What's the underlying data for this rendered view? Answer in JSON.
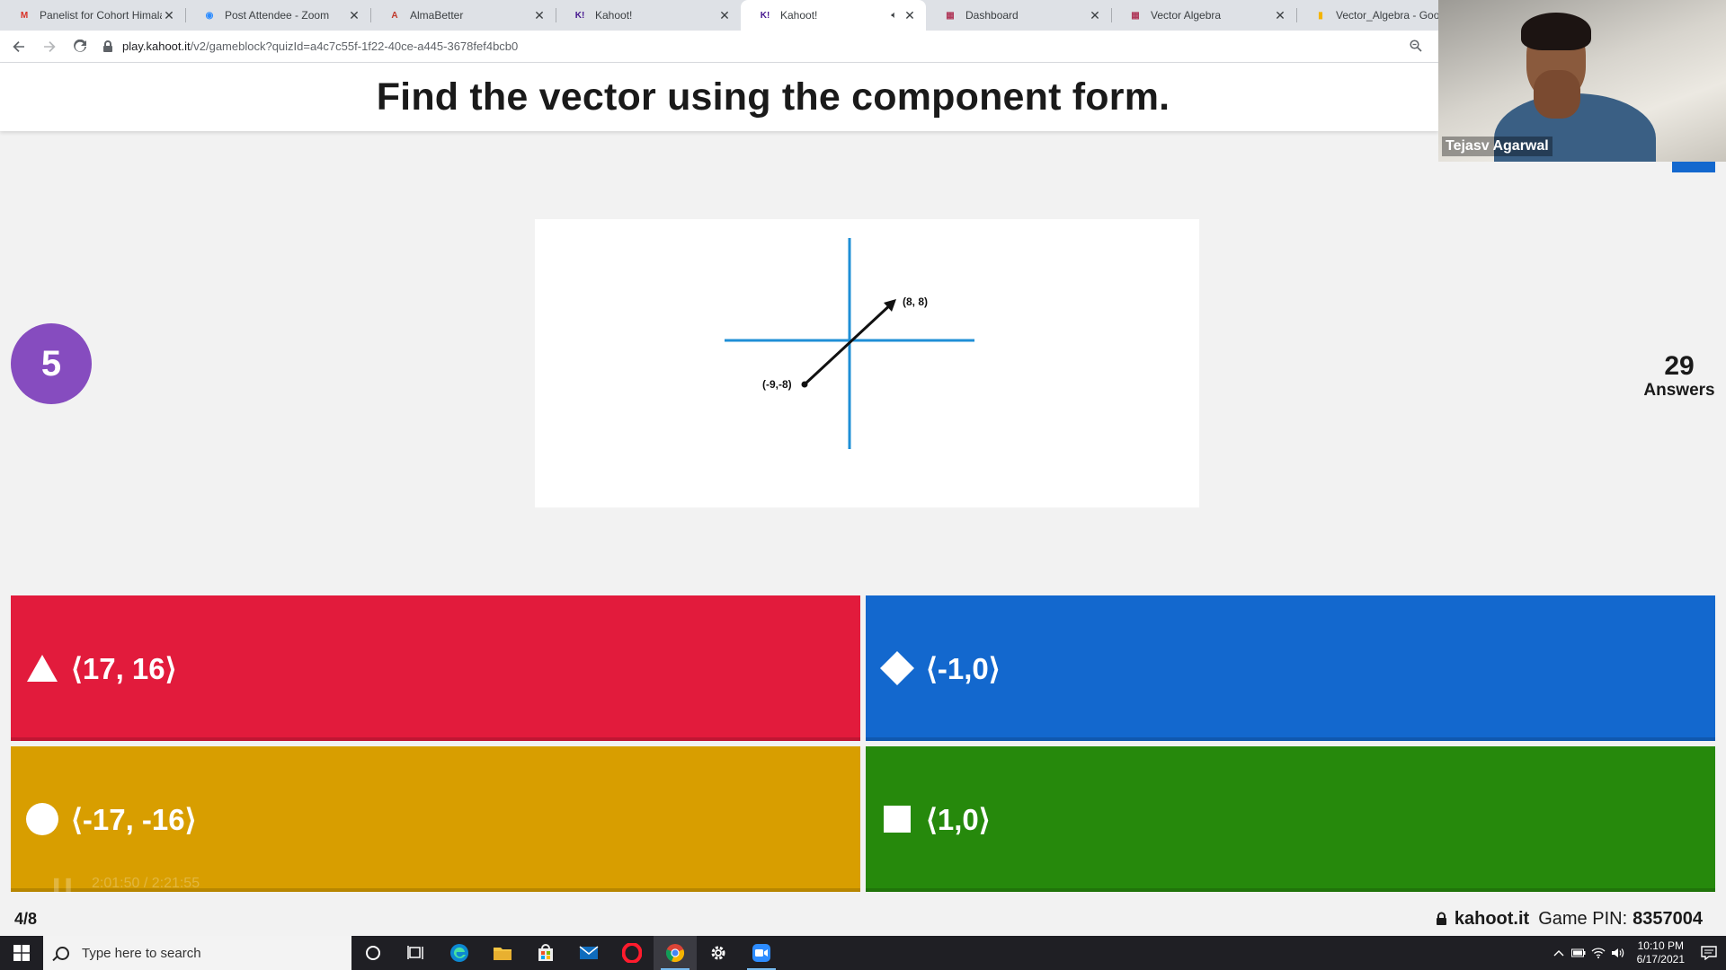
{
  "browser": {
    "tabs": [
      {
        "title": "Panelist for Cohort Himala",
        "favicon": "gmail-icon",
        "favicon_color": "#d93025",
        "active": false
      },
      {
        "title": "Post Attendee - Zoom",
        "favicon": "zoom-icon",
        "favicon_color": "#2d8cff",
        "active": false
      },
      {
        "title": "AlmaBetter",
        "favicon": "almabetter-icon",
        "favicon_color": "#c0392b",
        "active": false
      },
      {
        "title": "Kahoot!",
        "favicon": "kahoot-icon",
        "favicon_color": "#46178f",
        "active": false
      },
      {
        "title": "Kahoot!",
        "favicon": "kahoot-icon",
        "favicon_color": "#46178f",
        "active": true,
        "audio": true
      },
      {
        "title": "Dashboard",
        "favicon": "dashboard-icon",
        "favicon_color": "#b03a5b",
        "active": false
      },
      {
        "title": "Vector Algebra",
        "favicon": "dashboard-icon",
        "favicon_color": "#b03a5b",
        "active": false
      },
      {
        "title": "Vector_Algebra - Goo",
        "favicon": "slides-icon",
        "favicon_color": "#f4b400",
        "active": false
      }
    ],
    "url_host": "play.kahoot.it",
    "url_path": "/v2/gameblock?quizId=a4c7c55f-1f22-40ce-a445-3678fef4bcb0"
  },
  "kahoot": {
    "question": "Find the vector using the component form.",
    "countdown": "5",
    "answers_count": "29",
    "answers_label": "Answers",
    "diagram": {
      "start_label": "(-9,-8)",
      "end_label": "(8, 8)"
    },
    "options": [
      {
        "text": "⟨17, 16⟩",
        "shape": "triangle",
        "color": "#e21b3c"
      },
      {
        "text": "⟨-1,0⟩",
        "shape": "diamond",
        "color": "#1368ce"
      },
      {
        "text": "⟨-17, -16⟩",
        "shape": "circle",
        "color": "#d89e00"
      },
      {
        "text": "⟨1,0⟩",
        "shape": "square",
        "color": "#26890c"
      }
    ],
    "ghost_time": "2:01:50 / 2:21:55",
    "progress": "4/8",
    "host": "kahoot.it",
    "pin_label": "Game PIN:",
    "pin": "8357004"
  },
  "video": {
    "participant_name": "Tejasv Agarwal"
  },
  "taskbar": {
    "search_placeholder": "Type here to search",
    "time": "10:10 PM",
    "date": "6/17/2021"
  }
}
